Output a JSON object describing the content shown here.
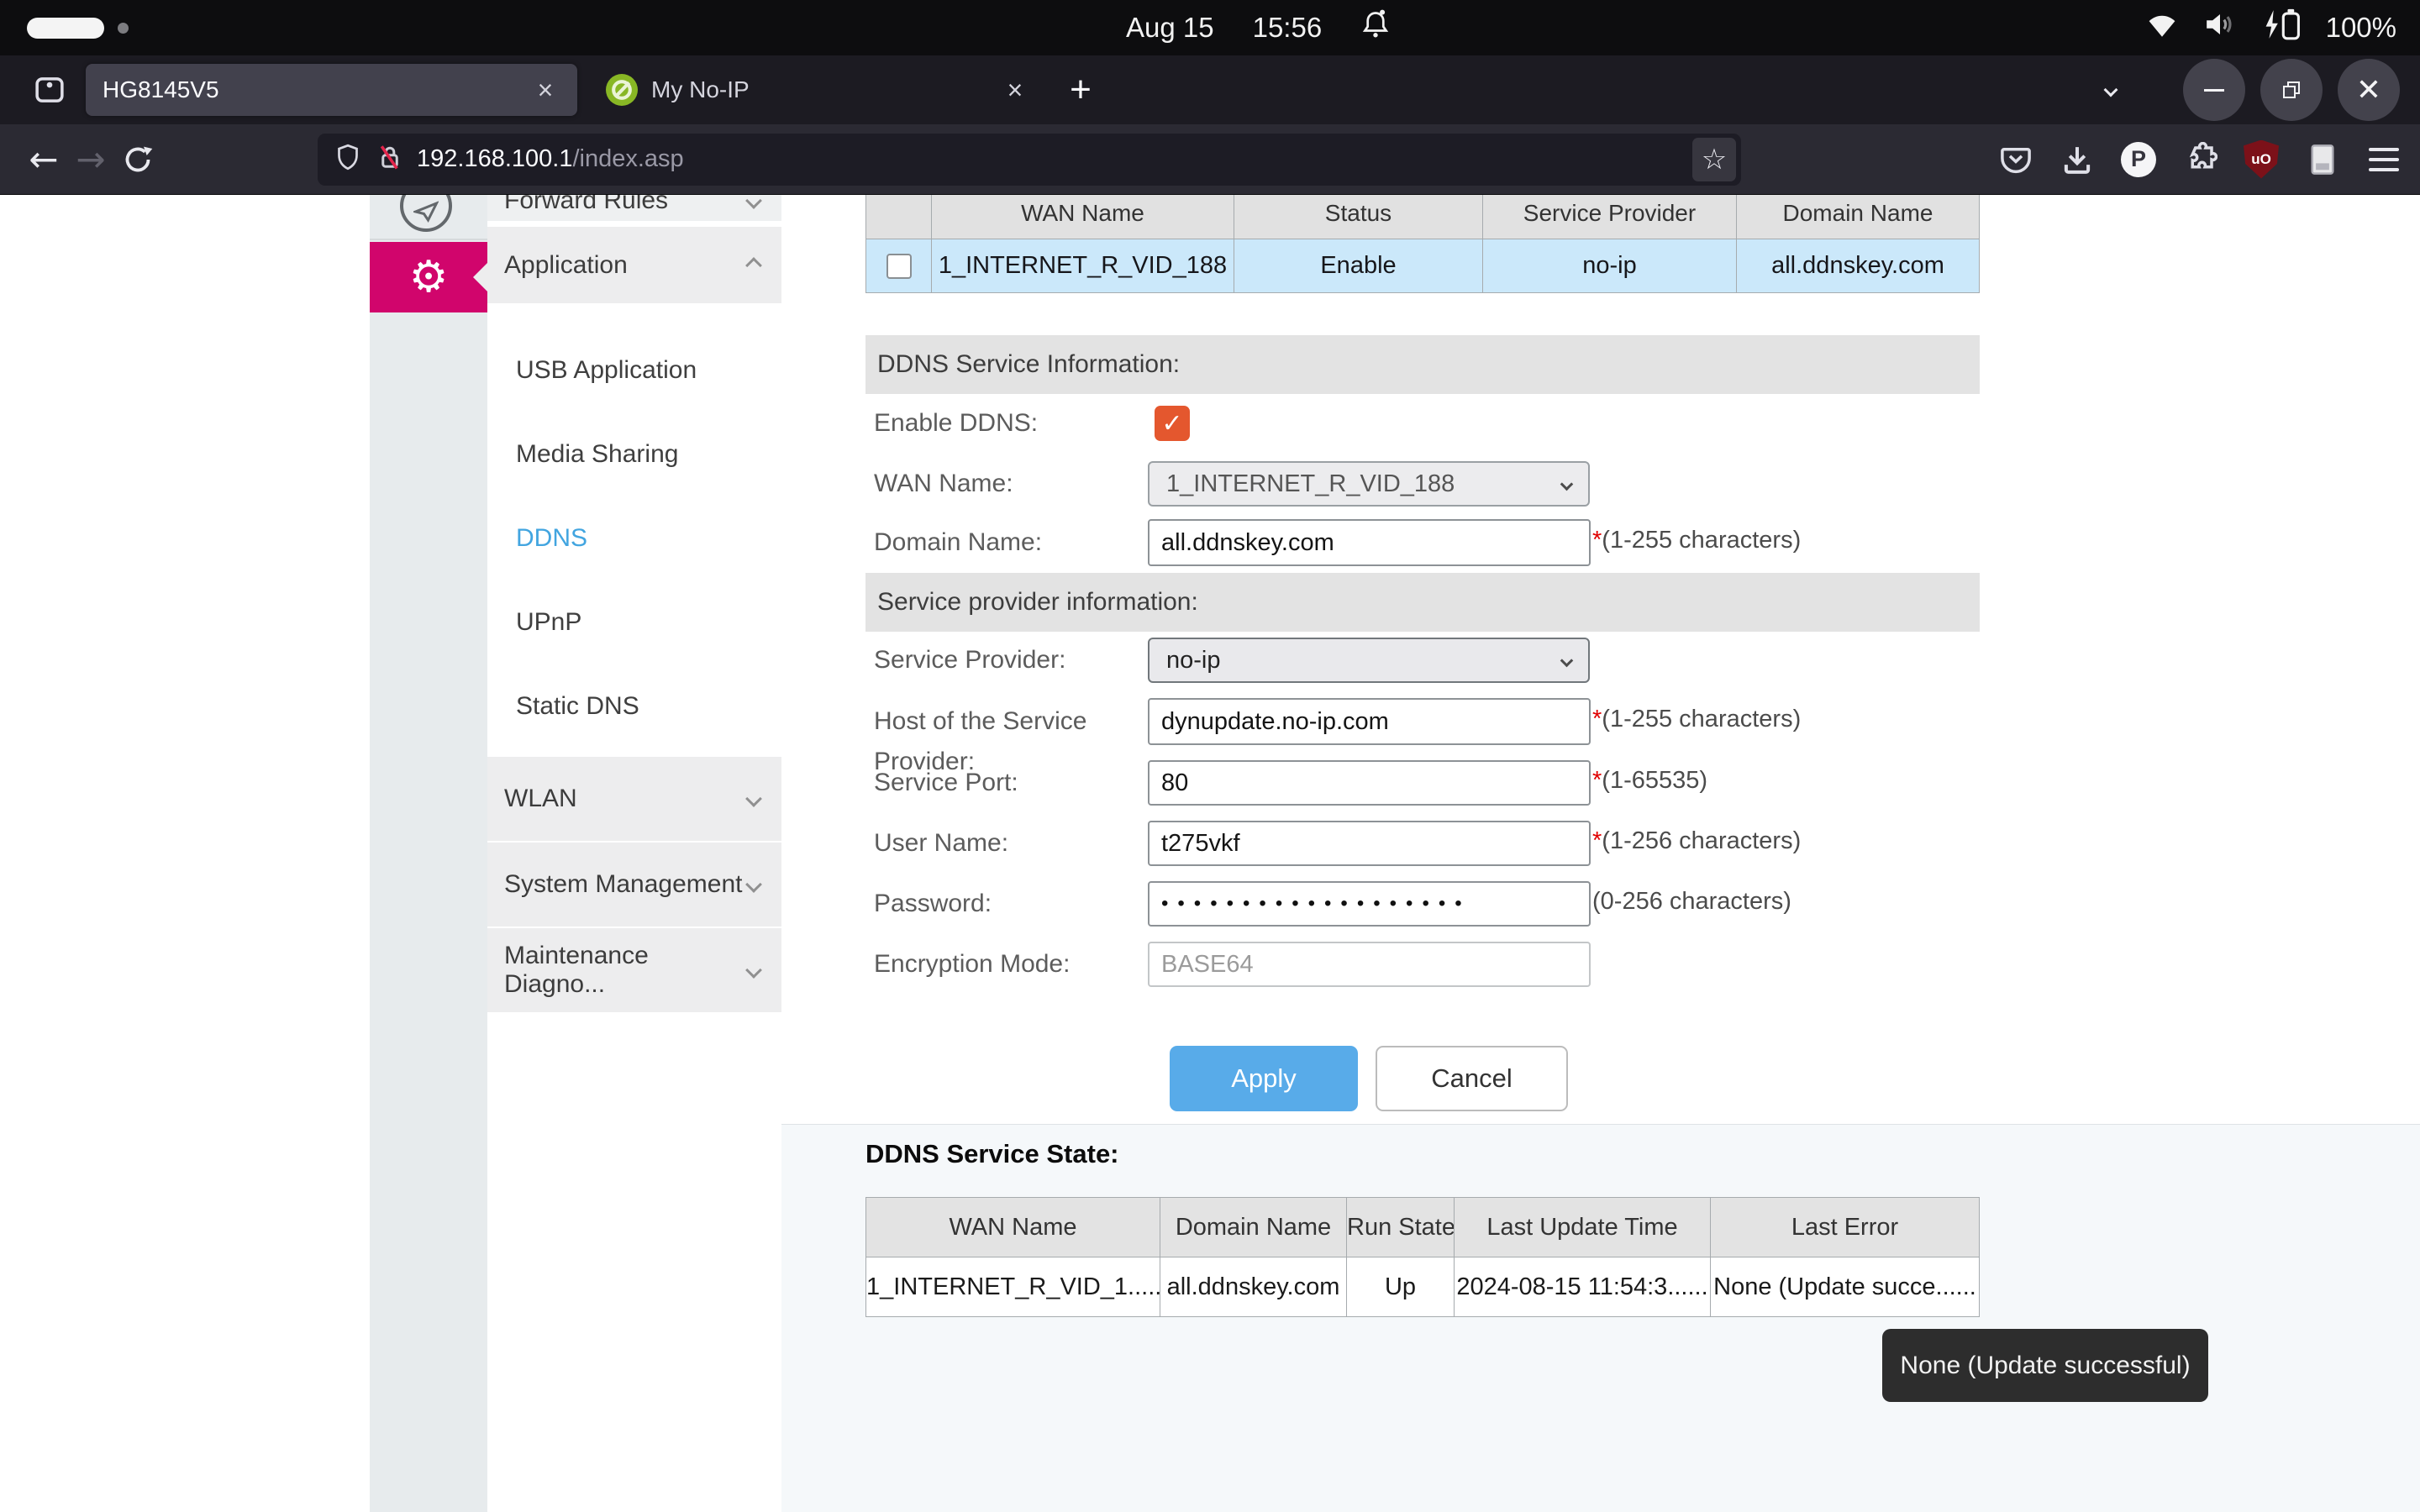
{
  "colors": {
    "accent_pink": "#d1056c",
    "link_blue": "#42a5e0",
    "apply_blue": "#58abe9",
    "checkbox_orange": "#e4572e",
    "row_highlight_blue": "#cbe8fa"
  },
  "system_bar": {
    "date": "Aug 15",
    "time": "15:56",
    "battery": "100%"
  },
  "browser": {
    "tab1": "HG8145V5",
    "tab2": "My No-IP",
    "new_tab": "+",
    "close_glyph": "×",
    "url_host": "192.168.100.1",
    "url_path": "/index.asp",
    "star_glyph": "☆",
    "back_glyph": "←",
    "forward_glyph": "→",
    "p_badge": "P",
    "ublock_label": "uO"
  },
  "sidebar": {
    "forward_rules": "Forward Rules",
    "application": "Application",
    "gear_glyph": "⚙",
    "sub_items": [
      "USB Application",
      "Media Sharing",
      "DDNS",
      "UPnP",
      "Static DNS"
    ],
    "collapsed": [
      "WLAN",
      "System Management",
      "Maintenance Diagno..."
    ]
  },
  "top_table": {
    "headers": [
      "WAN Name",
      "Status",
      "Service Provider",
      "Domain Name"
    ],
    "row": {
      "wan": "1_INTERNET_R_VID_188",
      "status": "Enable",
      "provider": "no-ip",
      "domain": "all.ddnskey.com"
    }
  },
  "form": {
    "section1": "DDNS Service Information:",
    "enable_label": "Enable DDNS:",
    "check_glyph": "✓",
    "wan_label": "WAN Name:",
    "wan_value": "1_INTERNET_R_VID_188",
    "domain_label": "Domain Name:",
    "domain_value": "all.ddnskey.com",
    "required": "*",
    "domain_hint": "(1-255 characters)",
    "section2": "Service provider information:",
    "provider_label": "Service Provider:",
    "provider_value": "no-ip",
    "host_label": "Host of the Service Provider:",
    "host_value": "dynupdate.no-ip.com",
    "host_hint": "(1-255 characters)",
    "port_label": "Service Port:",
    "port_value": "80",
    "port_hint": "(1-65535)",
    "user_label": "User Name:",
    "user_value": "t275vkf",
    "user_hint": "(1-256 characters)",
    "password_label": "Password:",
    "password_value": "•••••••••••••••••••",
    "password_hint": "(0-256 characters)",
    "enc_label": "Encryption Mode:",
    "enc_value": "BASE64",
    "apply": "Apply",
    "cancel": "Cancel"
  },
  "state": {
    "title": "DDNS Service State:",
    "headers": [
      "WAN Name",
      "Domain Name",
      "Run State",
      "Last Update Time",
      "Last Error"
    ],
    "row": [
      "1_INTERNET_R_VID_1......",
      "all.ddnskey.com",
      "Up",
      "2024-08-15 11:54:3......",
      "None (Update succe......"
    ]
  },
  "tooltip": "None (Update successful)"
}
